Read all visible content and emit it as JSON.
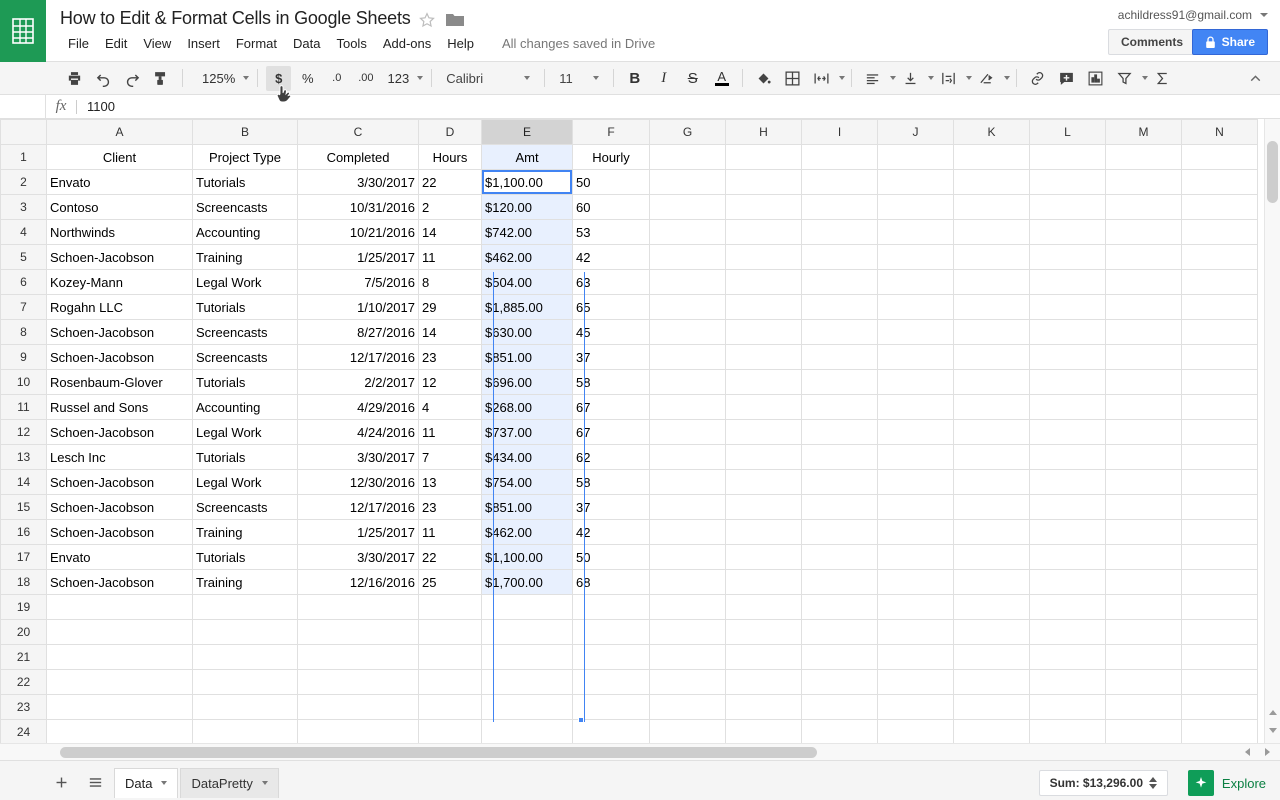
{
  "app": {
    "logo_icon": "sheets-grid-icon",
    "doc_title": "How to Edit & Format Cells in Google Sheets",
    "star_icon": "star-icon",
    "folder_icon": "folder-icon",
    "save_state": "All changes saved in Drive",
    "account_email": "achildress91@gmail.com",
    "comments_label": "Comments",
    "share_label": "Share",
    "share_lock_icon": "lock-icon",
    "accent_blue": "#4285f4",
    "brand_green": "#1e9a55",
    "selection_blue": "#4184f3",
    "selection_tint": "#e8f0fe"
  },
  "menu": {
    "items": [
      {
        "label": "File"
      },
      {
        "label": "Edit"
      },
      {
        "label": "View"
      },
      {
        "label": "Insert"
      },
      {
        "label": "Format"
      },
      {
        "label": "Data"
      },
      {
        "label": "Tools"
      },
      {
        "label": "Add-ons"
      },
      {
        "label": "Help"
      }
    ]
  },
  "toolbar": {
    "print_icon": "print-icon",
    "undo_icon": "undo-icon",
    "redo_icon": "redo-icon",
    "paint_format_icon": "paint-format-icon",
    "zoom_value": "125%",
    "currency_label": "$",
    "percent_label": "%",
    "decrease_decimal_label": ".0",
    "increase_decimal_label": ".00",
    "more_formats_label": "123",
    "font_name": "Calibri",
    "font_size": "11",
    "bold_label": "B",
    "italic_label": "I",
    "strikethrough_label": "S",
    "text_color_label": "A",
    "fill_color_icon": "fill-color-icon",
    "borders_icon": "borders-icon",
    "merge_cells_icon": "merge-cells-icon",
    "halign_icon": "horizontal-align-icon",
    "valign_icon": "vertical-align-icon",
    "text_wrap_icon": "text-wrapping-icon",
    "text_rotation_icon": "text-rotation-icon",
    "insert_link_icon": "insert-link-icon",
    "insert_comment_icon": "insert-comment-icon",
    "insert_chart_icon": "insert-chart-icon",
    "filter_icon": "filter-icon",
    "functions_icon": "functions-sigma-icon",
    "collapse_icon": "collapse-toolbar-chevron-icon",
    "active_button": "currency-button"
  },
  "formula_bar": {
    "name_box_value": "",
    "fx_label": "fx",
    "formula_value": "1100"
  },
  "grid": {
    "columns": [
      "A",
      "B",
      "C",
      "D",
      "E",
      "F",
      "G",
      "H",
      "I",
      "J",
      "K",
      "L",
      "M",
      "N"
    ],
    "selected_column": "E",
    "active_cell": "E2",
    "header_row": {
      "row_number": "1",
      "cells": [
        "Client",
        "Project Type",
        "Completed",
        "Hours",
        "Amt",
        "Hourly"
      ]
    },
    "rows": [
      {
        "n": "2",
        "client": "Envato",
        "type": "Tutorials",
        "completed": "3/30/2017",
        "hours": "22",
        "amt": "$1,100.00",
        "hourly": "50"
      },
      {
        "n": "3",
        "client": "Contoso",
        "type": "Screencasts",
        "completed": "10/31/2016",
        "hours": "2",
        "amt": "$120.00",
        "hourly": "60"
      },
      {
        "n": "4",
        "client": "Northwinds",
        "type": "Accounting",
        "completed": "10/21/2016",
        "hours": "14",
        "amt": "$742.00",
        "hourly": "53"
      },
      {
        "n": "5",
        "client": "Schoen-Jacobson",
        "type": "Training",
        "completed": "1/25/2017",
        "hours": "11",
        "amt": "$462.00",
        "hourly": "42"
      },
      {
        "n": "6",
        "client": "Kozey-Mann",
        "type": "Legal Work",
        "completed": "7/5/2016",
        "hours": "8",
        "amt": "$504.00",
        "hourly": "63"
      },
      {
        "n": "7",
        "client": "Rogahn LLC",
        "type": "Tutorials",
        "completed": "1/10/2017",
        "hours": "29",
        "amt": "$1,885.00",
        "hourly": "65"
      },
      {
        "n": "8",
        "client": "Schoen-Jacobson",
        "type": "Screencasts",
        "completed": "8/27/2016",
        "hours": "14",
        "amt": "$630.00",
        "hourly": "45"
      },
      {
        "n": "9",
        "client": "Schoen-Jacobson",
        "type": "Screencasts",
        "completed": "12/17/2016",
        "hours": "23",
        "amt": "$851.00",
        "hourly": "37"
      },
      {
        "n": "10",
        "client": "Rosenbaum-Glover",
        "type": "Tutorials",
        "completed": "2/2/2017",
        "hours": "12",
        "amt": "$696.00",
        "hourly": "58"
      },
      {
        "n": "11",
        "client": "Russel and Sons",
        "type": "Accounting",
        "completed": "4/29/2016",
        "hours": "4",
        "amt": "$268.00",
        "hourly": "67"
      },
      {
        "n": "12",
        "client": "Schoen-Jacobson",
        "type": "Legal Work",
        "completed": "4/24/2016",
        "hours": "11",
        "amt": "$737.00",
        "hourly": "67"
      },
      {
        "n": "13",
        "client": "Lesch Inc",
        "type": "Tutorials",
        "completed": "3/30/2017",
        "hours": "7",
        "amt": "$434.00",
        "hourly": "62"
      },
      {
        "n": "14",
        "client": "Schoen-Jacobson",
        "type": "Legal Work",
        "completed": "12/30/2016",
        "hours": "13",
        "amt": "$754.00",
        "hourly": "58"
      },
      {
        "n": "15",
        "client": "Schoen-Jacobson",
        "type": "Screencasts",
        "completed": "12/17/2016",
        "hours": "23",
        "amt": "$851.00",
        "hourly": "37"
      },
      {
        "n": "16",
        "client": "Schoen-Jacobson",
        "type": "Training",
        "completed": "1/25/2017",
        "hours": "11",
        "amt": "$462.00",
        "hourly": "42"
      },
      {
        "n": "17",
        "client": "Envato",
        "type": "Tutorials",
        "completed": "3/30/2017",
        "hours": "22",
        "amt": "$1,100.00",
        "hourly": "50"
      },
      {
        "n": "18",
        "client": "Schoen-Jacobson",
        "type": "Training",
        "completed": "12/16/2016",
        "hours": "25",
        "amt": "$1,700.00",
        "hourly": "68"
      },
      {
        "n": "19",
        "client": "",
        "type": "",
        "completed": "",
        "hours": "",
        "amt": "",
        "hourly": ""
      },
      {
        "n": "20",
        "client": "",
        "type": "",
        "completed": "",
        "hours": "",
        "amt": "",
        "hourly": ""
      },
      {
        "n": "21",
        "client": "",
        "type": "",
        "completed": "",
        "hours": "",
        "amt": "",
        "hourly": ""
      },
      {
        "n": "22",
        "client": "",
        "type": "",
        "completed": "",
        "hours": "",
        "amt": "",
        "hourly": ""
      },
      {
        "n": "23",
        "client": "",
        "type": "",
        "completed": "",
        "hours": "",
        "amt": "",
        "hourly": ""
      },
      {
        "n": "24",
        "client": "",
        "type": "",
        "completed": "",
        "hours": "",
        "amt": "",
        "hourly": ""
      }
    ]
  },
  "sheet_bar": {
    "add_sheet_icon": "add-sheet-plus-icon",
    "all_sheets_icon": "all-sheets-list-icon",
    "tabs": [
      {
        "label": "Data",
        "active": true
      },
      {
        "label": "DataPretty",
        "active": false
      }
    ],
    "sum_label": "Sum: $13,296.00",
    "explore_label": "Explore",
    "explore_icon": "explore-star-icon"
  }
}
